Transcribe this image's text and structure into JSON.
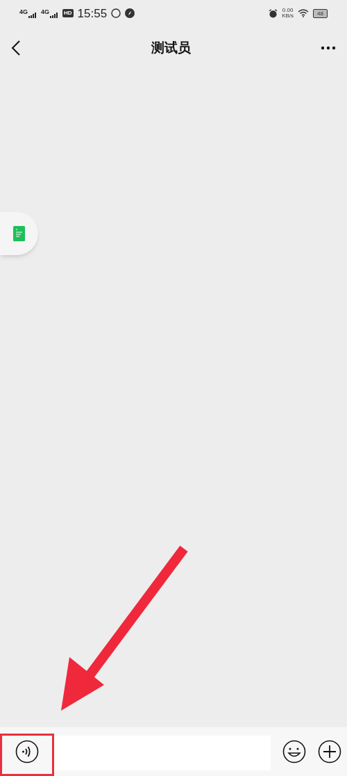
{
  "status_bar": {
    "signals": [
      "4G",
      "4G"
    ],
    "hd": "HD",
    "time": "15:55",
    "speed": "0.00",
    "speed_unit": "KB/s",
    "battery": "48"
  },
  "header": {
    "title": "测试员"
  }
}
